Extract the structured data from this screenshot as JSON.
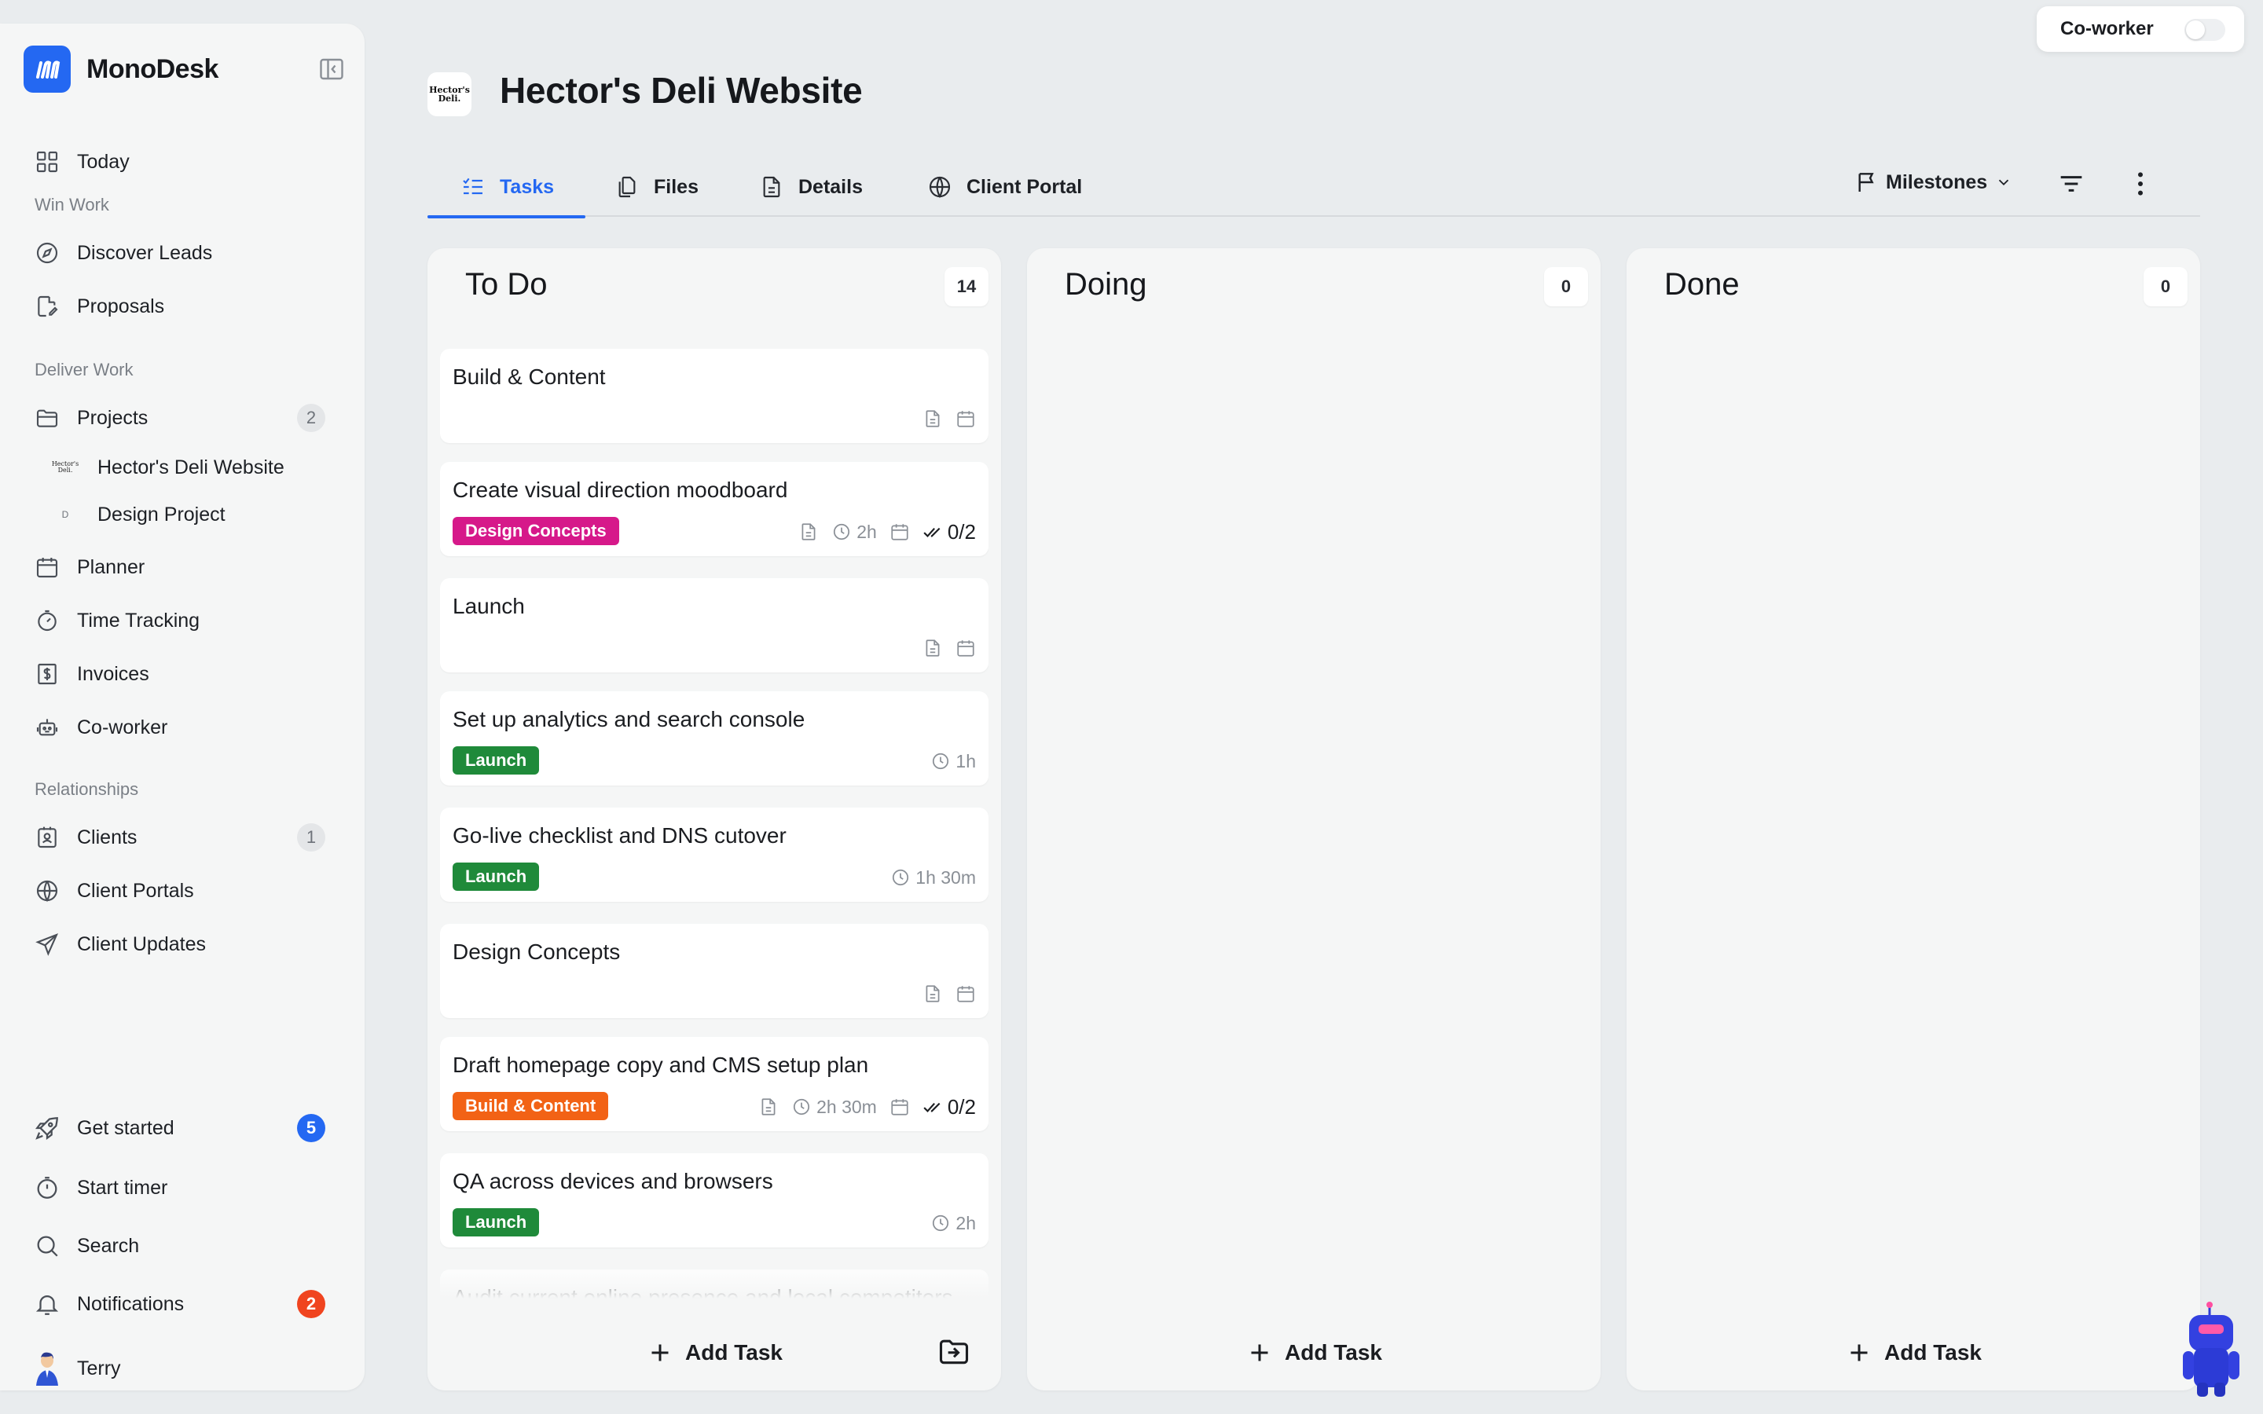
{
  "app": {
    "name": "MonoDesk"
  },
  "toggle": {
    "label": "Co-worker"
  },
  "sidebar": {
    "today": "Today",
    "section_win": "Win Work",
    "discover_leads": "Discover Leads",
    "proposals": "Proposals",
    "section_deliver": "Deliver Work",
    "projects": {
      "label": "Projects",
      "count": "2"
    },
    "project_items": [
      {
        "label": "Hector's Deli Website",
        "icon_text": "Hector's Deli."
      },
      {
        "label": "Design Project",
        "icon_text": "D"
      }
    ],
    "planner": "Planner",
    "time_tracking": "Time Tracking",
    "invoices": "Invoices",
    "coworker": "Co-worker",
    "section_relationships": "Relationships",
    "clients": {
      "label": "Clients",
      "count": "1"
    },
    "client_portals": "Client Portals",
    "client_updates": "Client Updates",
    "get_started": {
      "label": "Get started",
      "count": "5"
    },
    "start_timer": "Start timer",
    "search": "Search",
    "notifications": {
      "label": "Notifications",
      "count": "2"
    },
    "user": "Terry"
  },
  "project": {
    "title": "Hector's Deli Website",
    "logo_text": "Hector's Deli."
  },
  "tabs": [
    {
      "label": "Tasks",
      "icon": "tasks-icon"
    },
    {
      "label": "Files",
      "icon": "files-icon"
    },
    {
      "label": "Details",
      "icon": "document-icon"
    },
    {
      "label": "Client Portal",
      "icon": "globe-icon"
    }
  ],
  "toolbar": {
    "milestones": "Milestones"
  },
  "columns": [
    {
      "title": "To Do",
      "count": "14",
      "add_label": "Add Task"
    },
    {
      "title": "Doing",
      "count": "0",
      "add_label": "Add Task"
    },
    {
      "title": "Done",
      "count": "0",
      "add_label": "Add Task"
    }
  ],
  "cards": [
    {
      "title": "Build & Content",
      "tag": "",
      "meta": [
        "doc",
        "calendar"
      ]
    },
    {
      "title": "Create visual direction moodboard",
      "tag": "Design Concepts",
      "tag_color": "#d6198a",
      "time": "2h",
      "checklist": "0/2",
      "meta": [
        "doc",
        "time",
        "calendar",
        "checklist"
      ]
    },
    {
      "title": "Launch",
      "tag": "",
      "meta": [
        "doc",
        "calendar"
      ]
    },
    {
      "title": "Set up analytics and search console",
      "tag": "Launch",
      "tag_color": "#1f8a3a",
      "time": "1h",
      "meta": [
        "time"
      ]
    },
    {
      "title": "Go-live checklist and DNS cutover",
      "tag": "Launch",
      "tag_color": "#1f8a3a",
      "time": "1h 30m",
      "meta": [
        "time"
      ]
    },
    {
      "title": "Design Concepts",
      "tag": "",
      "meta": [
        "doc",
        "calendar"
      ]
    },
    {
      "title": "Draft homepage copy and CMS setup plan",
      "tag": "Build & Content",
      "tag_color": "#f26215",
      "time": "2h 30m",
      "checklist": "0/2",
      "meta": [
        "doc",
        "time",
        "calendar",
        "checklist"
      ]
    },
    {
      "title": "QA across devices and browsers",
      "tag": "Launch",
      "tag_color": "#1f8a3a",
      "time": "2h",
      "meta": [
        "time"
      ]
    },
    {
      "title": "Audit current online presence and local competitors",
      "tag": "",
      "meta": []
    }
  ]
}
